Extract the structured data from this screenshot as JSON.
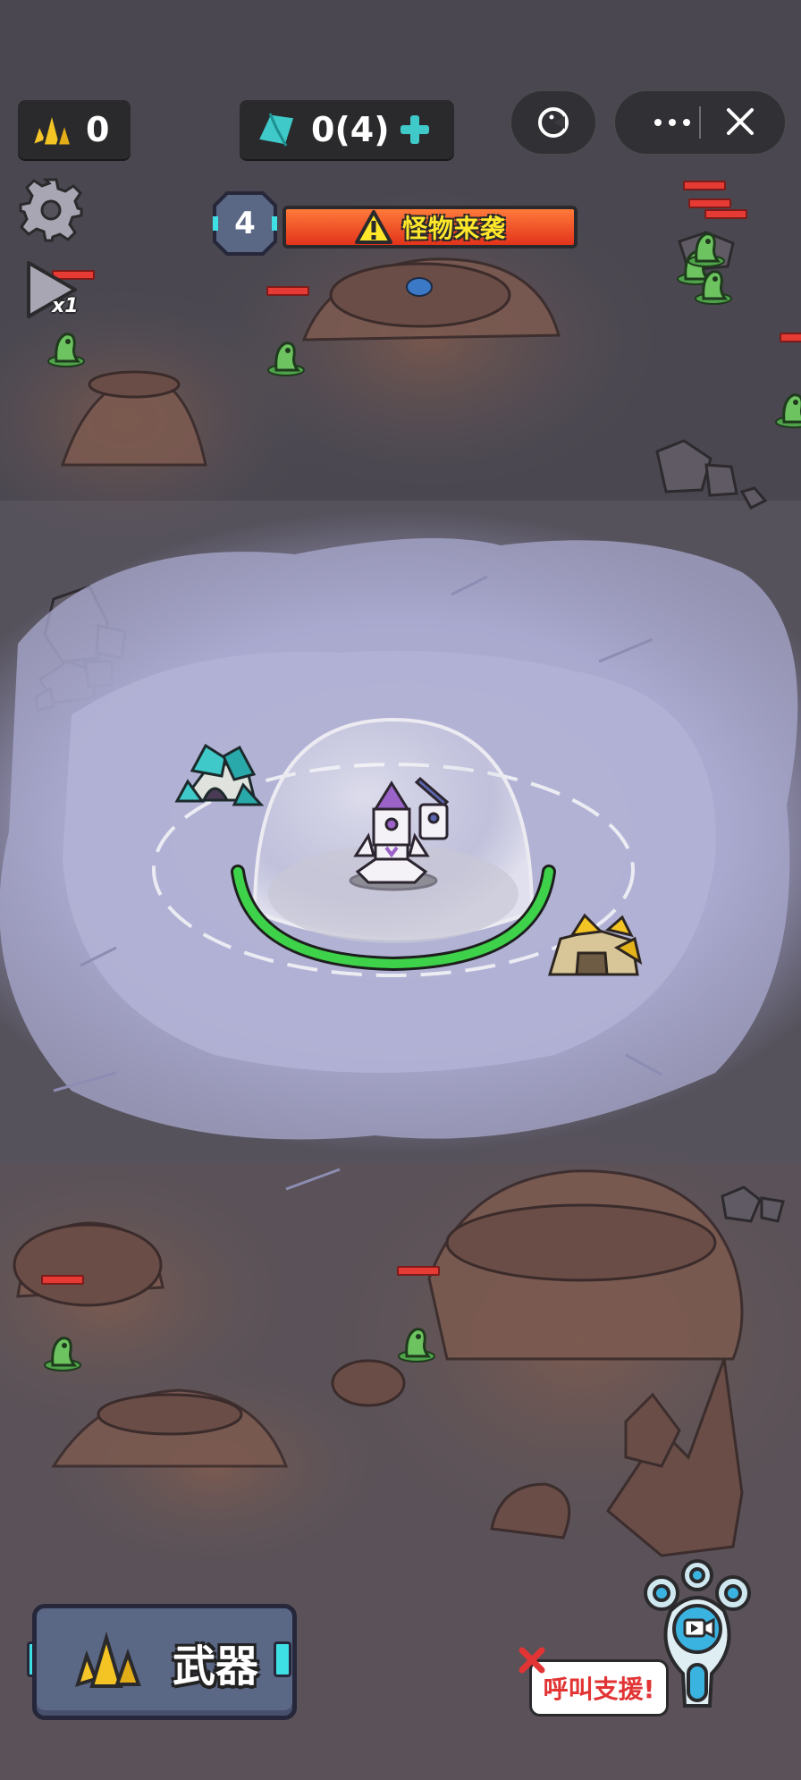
{
  "hud": {
    "gold_count": "0",
    "crystal_count": "0(4)",
    "wave_number": "4",
    "alert_text": "怪物来袭",
    "speed_label": "x1"
  },
  "bottom": {
    "weapons_label": "武器",
    "call_support_label": "呼叫支援!"
  },
  "game_state": {
    "base_health_fraction": 1.0,
    "enemy_count": 10
  },
  "colors": {
    "health_green": "#3ed14a",
    "alert_red": "#e2331b",
    "alert_text_yellow": "#ffe82a",
    "crystal_teal": "#3fc9c9",
    "gold": "#f3c423"
  },
  "icons": [
    "gold-crystal-icon",
    "teal-crystal-icon",
    "plus-icon",
    "pause-menu-icon",
    "more-icon",
    "close-icon",
    "gear-icon",
    "play-speed-icon",
    "warning-icon",
    "video-camera-icon"
  ]
}
